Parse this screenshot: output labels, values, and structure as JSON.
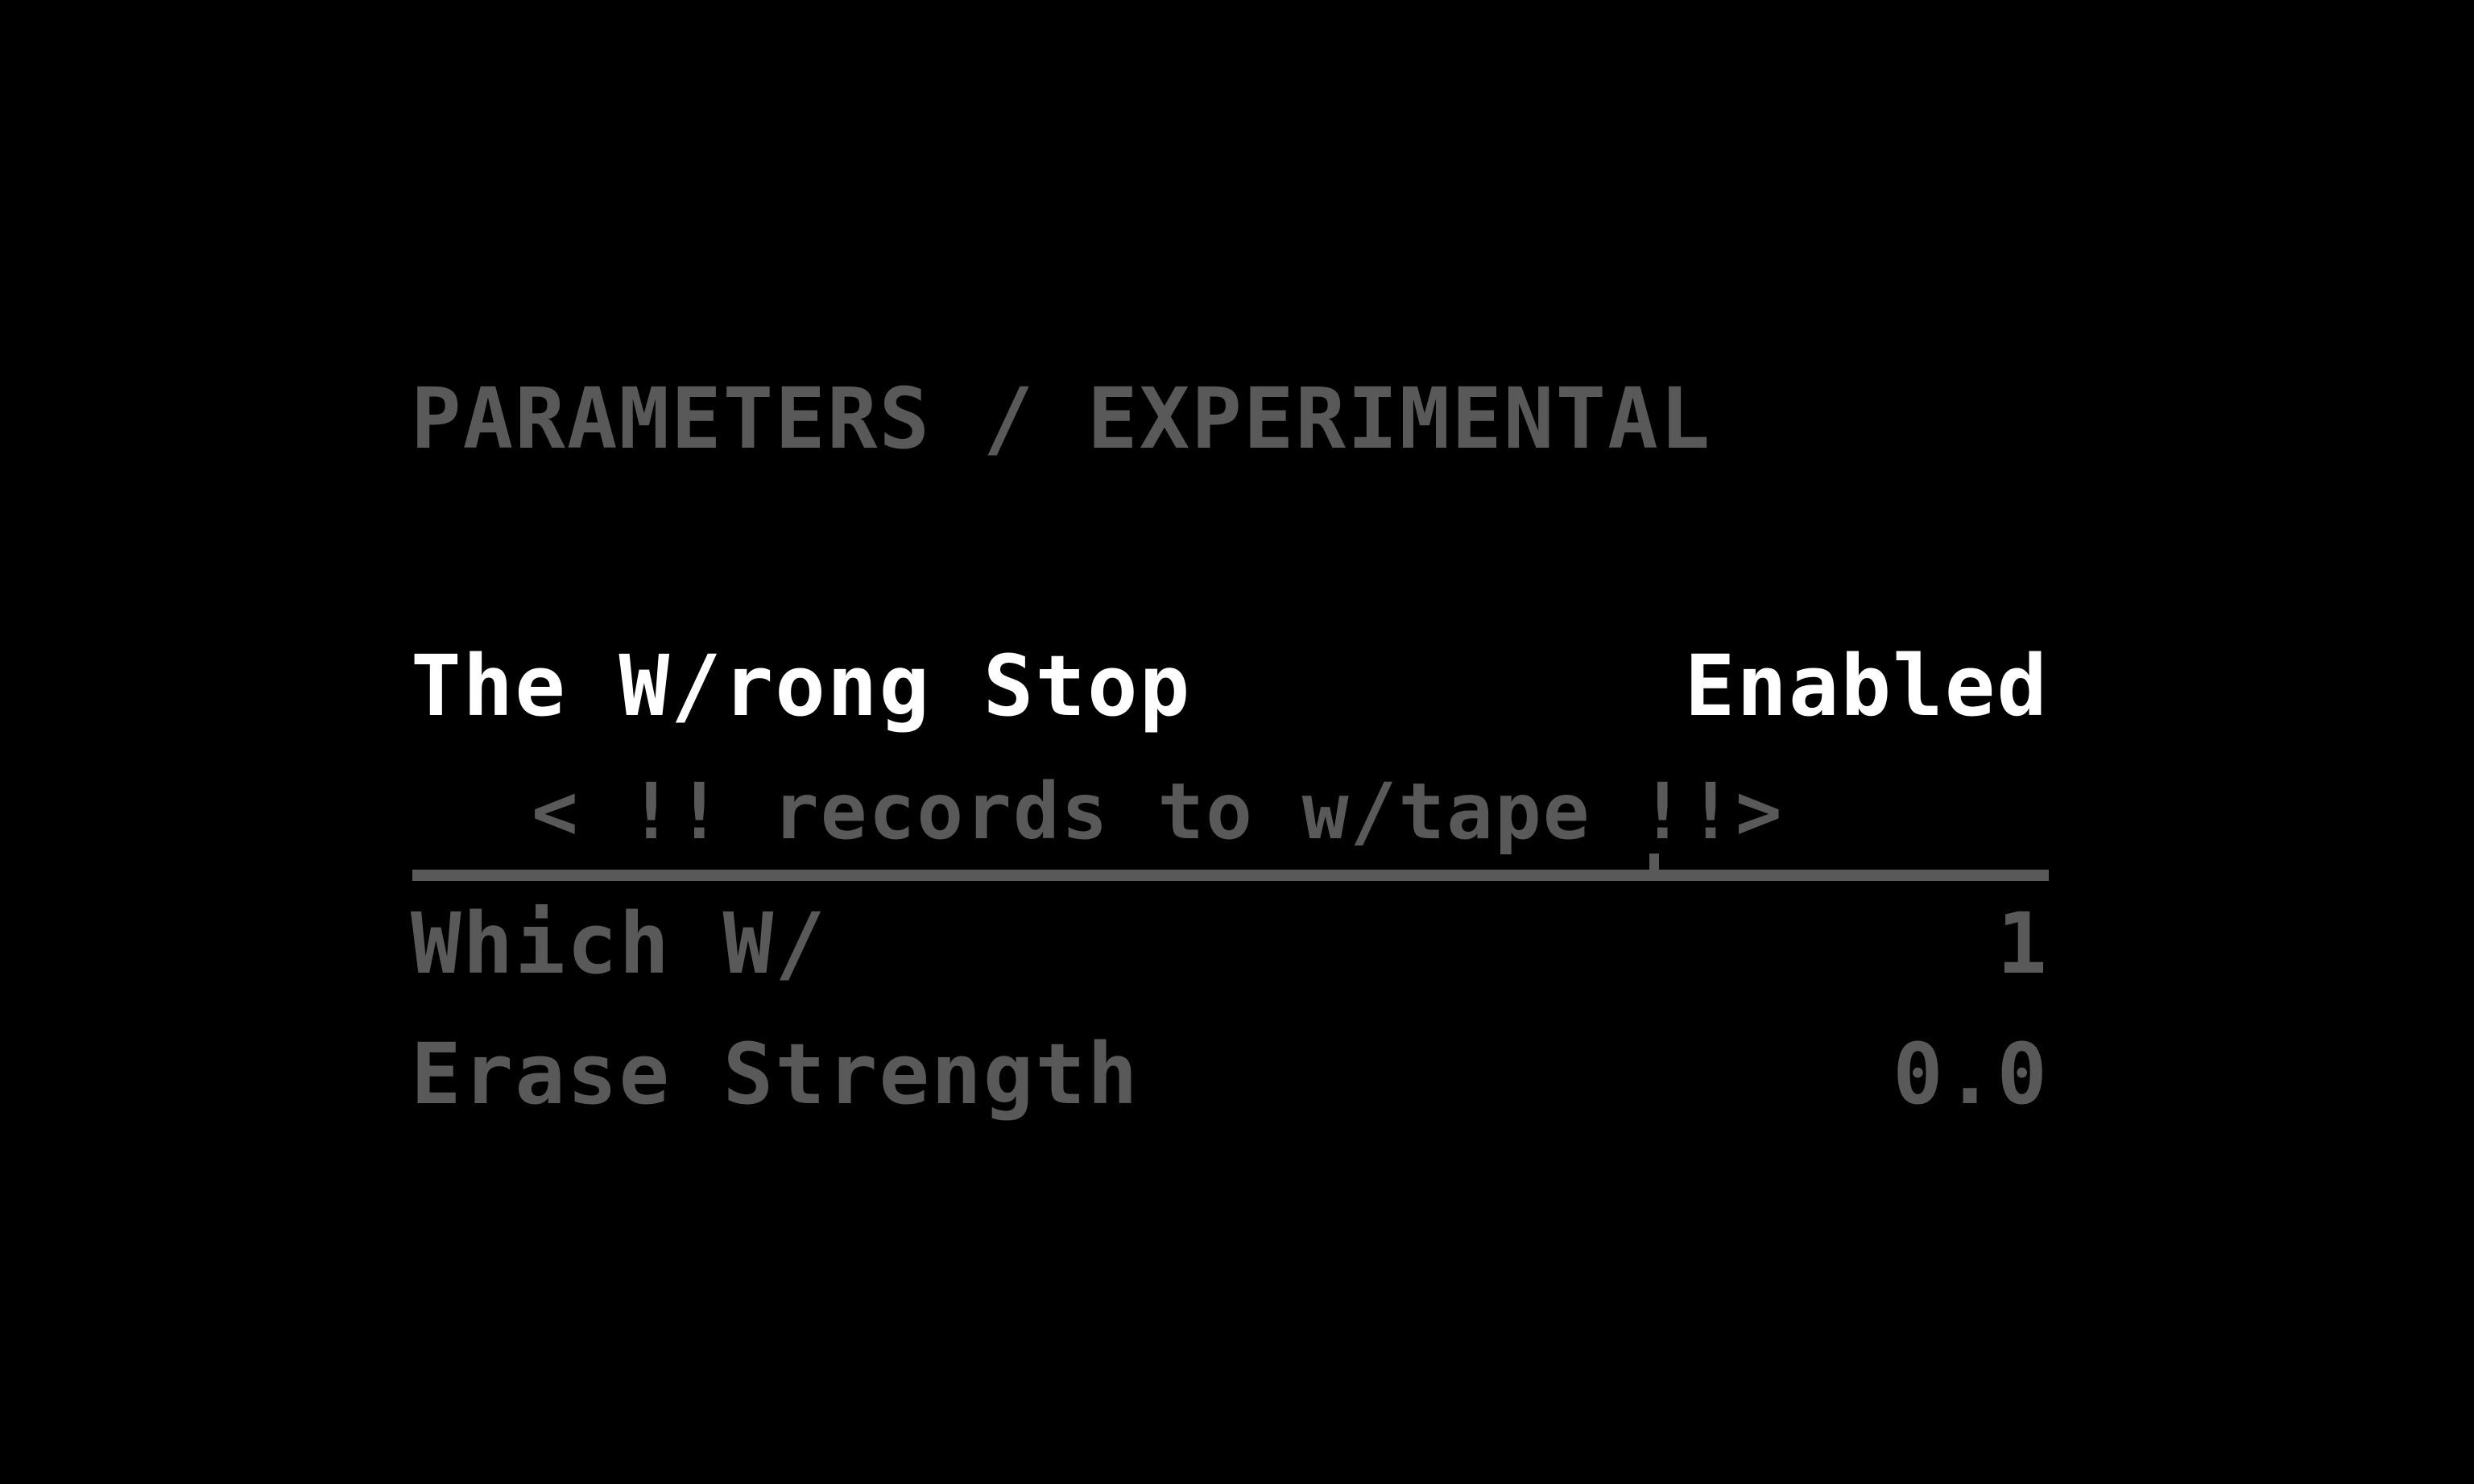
{
  "header": {
    "title": "PARAMETERS / EXPERIMENTAL"
  },
  "params": [
    {
      "label": "The W/rong Stop",
      "value": "Enabled",
      "selected": true
    },
    {
      "label": "Which W/",
      "value": "1",
      "selected": false
    },
    {
      "label": "Erase Strength",
      "value": "0.0",
      "selected": false
    }
  ],
  "hint": {
    "text": "< !! records to w/tape !!>"
  },
  "colors": {
    "background": "#000000",
    "active": "#ffffff",
    "inactive": "#595959"
  }
}
